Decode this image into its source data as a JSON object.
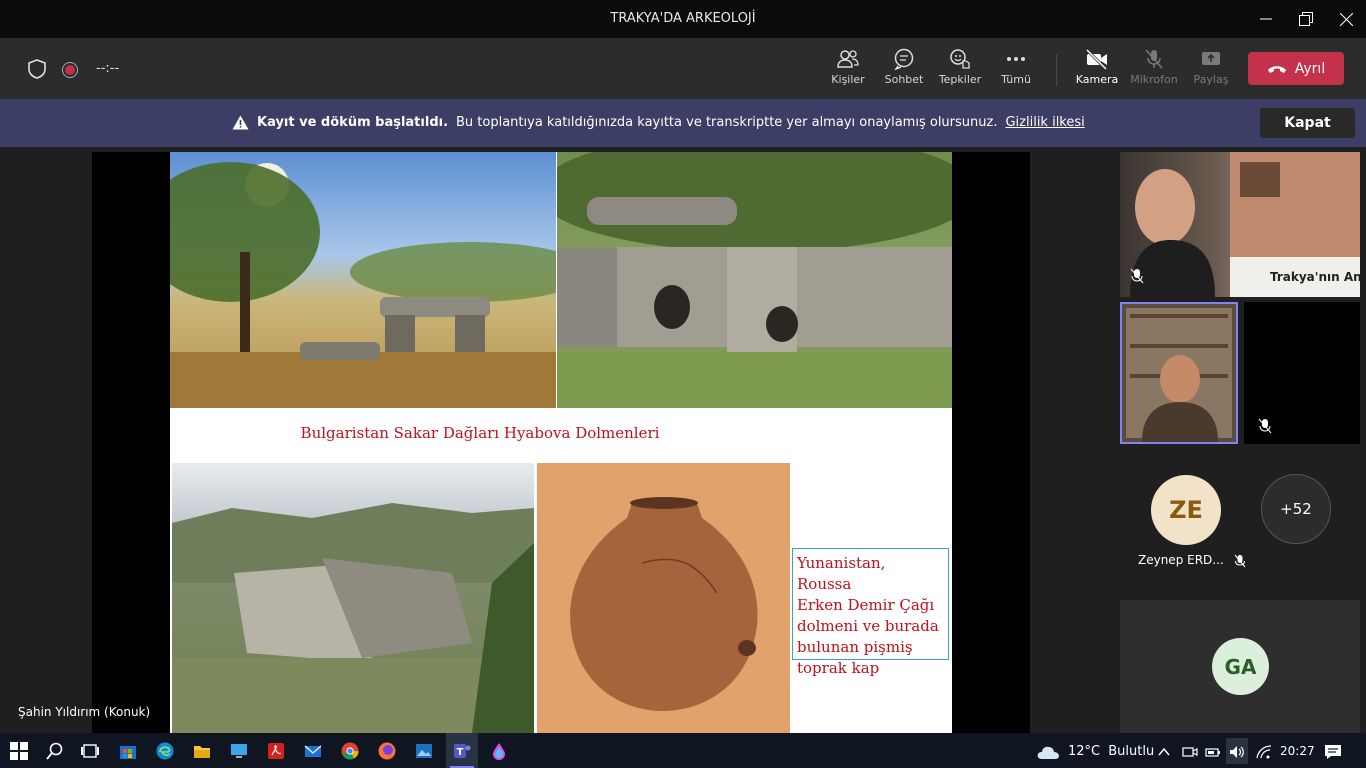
{
  "window": {
    "title": "TRAKYA'DA ARKEOLOJİ",
    "controls": [
      "minimize-icon",
      "restore-icon",
      "close-icon"
    ]
  },
  "meeting": {
    "timer": "--:--",
    "toolbar": [
      {
        "id": "people",
        "label": "Kişiler",
        "icon": "people-icon",
        "enabled": true
      },
      {
        "id": "chat",
        "label": "Sohbet",
        "icon": "chat-icon",
        "enabled": true
      },
      {
        "id": "reactions",
        "label": "Tepkiler",
        "icon": "reactions-icon",
        "enabled": true
      },
      {
        "id": "more",
        "label": "Tümü",
        "icon": "more-icon",
        "enabled": true
      },
      {
        "id": "camera",
        "label": "Kamera",
        "icon": "camera-off-icon",
        "enabled": true
      },
      {
        "id": "mic",
        "label": "Mikrofon",
        "icon": "mic-off-icon",
        "enabled": false
      },
      {
        "id": "share",
        "label": "Paylaş",
        "icon": "share-icon",
        "enabled": false
      }
    ],
    "leave_label": "Ayrıl",
    "leave_color": "#c4314b"
  },
  "banner": {
    "title": "Kayıt ve döküm başlatıldı.",
    "message": "Bu toplantıya katıldığınızda kayıtta ve transkriptte yer almayı onaylamış olursunuz.",
    "link": "Gizlilik ilkesi",
    "dismiss_label": "Kapat",
    "background": "#3d3e66"
  },
  "slide": {
    "caption_main": "Bulgaristan Sakar Dağları Hyabova Dolmenleri",
    "caption_side_lines": [
      "Yunanistan, Roussa",
      "Erken Demir Çağı",
      "dolmeni ve burada",
      "bulunan pişmiş",
      "toprak kap"
    ],
    "caption_color": "#c0101c"
  },
  "presenter": {
    "name": "Şahin Yıldırım (Konuk)"
  },
  "participants": {
    "tile1_overlay_text": "Trakya'nın Anıt M",
    "zeynep_initials": "ZE",
    "zeynep_name": "Zeynep ERD...",
    "overflow_count": "+52",
    "ga_initials": "GA"
  },
  "taskbar": {
    "weather_temp": "12°C",
    "weather_desc": "Bulutlu",
    "time": "20:27",
    "apps": [
      "start-icon",
      "search-icon",
      "task-view-icon",
      "store-icon",
      "edge-icon",
      "file-explorer-icon",
      "desktop-app-icon",
      "acrobat-icon",
      "mail-icon",
      "chrome-icon",
      "firefox-icon",
      "photos-icon",
      "teams-icon",
      "paint-icon"
    ]
  }
}
